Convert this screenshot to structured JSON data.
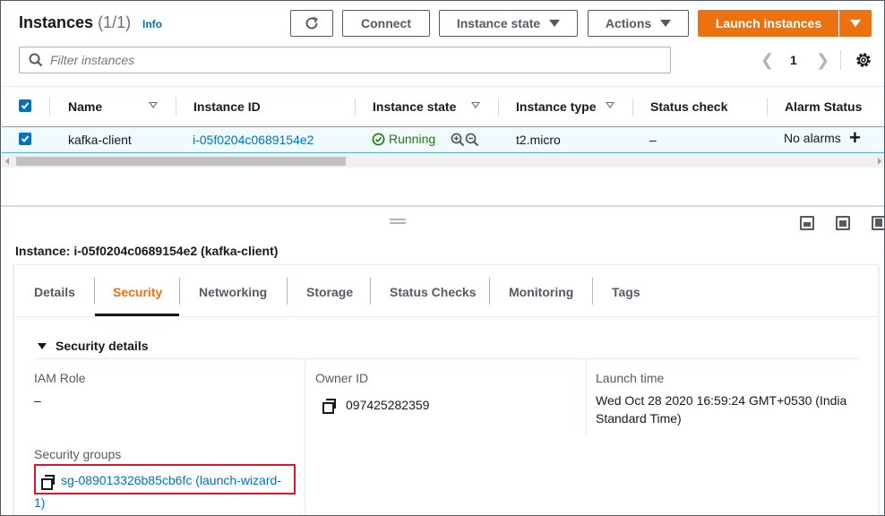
{
  "header": {
    "title": "Instances",
    "count": "(1/1)",
    "info_label": "Info",
    "connect_label": "Connect",
    "instance_state_label": "Instance state",
    "actions_label": "Actions",
    "launch_label": "Launch instances"
  },
  "search": {
    "placeholder": "Filter instances"
  },
  "pagination": {
    "current_page": "1"
  },
  "table": {
    "columns": [
      "Name",
      "Instance ID",
      "Instance state",
      "Instance type",
      "Status check",
      "Alarm Status"
    ],
    "rows": [
      {
        "name": "kafka-client",
        "instance_id": "i-05f0204c0689154e2",
        "state": "Running",
        "type": "t2.micro",
        "status_check": "–",
        "alarm_status": "No alarms"
      }
    ]
  },
  "details": {
    "title": "Instance: i-05f0204c0689154e2 (kafka-client)",
    "tabs": [
      "Details",
      "Security",
      "Networking",
      "Storage",
      "Status Checks",
      "Monitoring",
      "Tags"
    ],
    "active_tab": "Security",
    "section_title": "Security details",
    "iam_role_label": "IAM Role",
    "iam_role_value": "–",
    "owner_id_label": "Owner ID",
    "owner_id_value": "097425282359",
    "launch_time_label": "Launch time",
    "launch_time_line1": "Wed Oct 28 2020 16:59:24 GMT+0530 (India",
    "launch_time_line2": "Standard Time)",
    "security_groups_label": "Security groups",
    "security_group_line1": "sg-089013326b85cb6fc (launch-wizard-",
    "security_group_line2": "1)"
  },
  "colors": {
    "accent": "#ec7211",
    "link": "#0073bb",
    "running": "#1d8102",
    "highlight_box": "#e0142a"
  }
}
